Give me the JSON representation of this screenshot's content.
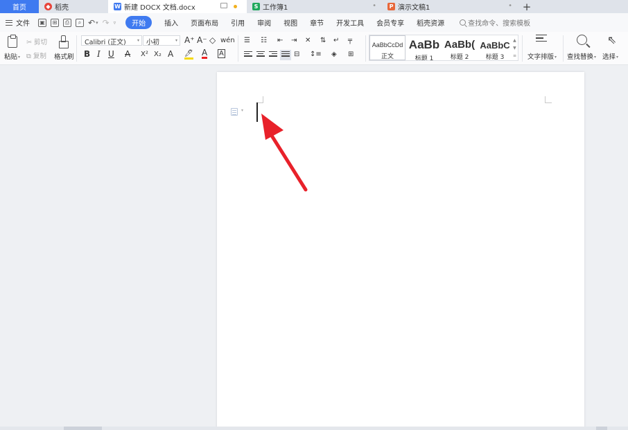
{
  "tabs": [
    {
      "id": "home",
      "label": "首页",
      "active": false
    },
    {
      "id": "daoke",
      "label": "稻壳",
      "icon": "daoke-logo-icon",
      "icon_color": "#e8443a"
    },
    {
      "id": "doc",
      "label": "新建 DOCX 文档.docx",
      "icon": "writer-doc-icon",
      "icon_color": "#3f7af0",
      "active": true
    },
    {
      "id": "sheet",
      "label": "工作簿1",
      "icon": "spreadsheet-icon",
      "icon_color": "#1fa85c"
    },
    {
      "id": "ppt",
      "label": "演示文稿1",
      "icon": "presentation-icon",
      "icon_color": "#e8673a"
    }
  ],
  "menu": {
    "file": "文件",
    "items": [
      "开始",
      "插入",
      "页面布局",
      "引用",
      "审阅",
      "视图",
      "章节",
      "开发工具",
      "会员专享",
      "稻壳资源"
    ],
    "active": "开始",
    "search_placeholder": "查找命令、搜索模板"
  },
  "ribbon": {
    "paste": "粘贴",
    "cut": "剪切",
    "copy": "复制",
    "format_painter": "格式刷",
    "font_name": "Calibri (正文)",
    "font_size": "小初",
    "font_glyphs": {
      "grow": "A⁺",
      "shrink": "A⁻",
      "clear": "◇",
      "phonetic": "wén",
      "bold": "B",
      "italic": "I",
      "underline": "U",
      "strike": "A",
      "superscript": "X²",
      "subscript": "X₂",
      "effect": "A",
      "highlight": "🖊",
      "font_color": "A",
      "char_border": "A"
    },
    "styles": [
      {
        "sample": "AaBbCcDd",
        "name": "正文"
      },
      {
        "sample": "AaBb",
        "name": "标题 1"
      },
      {
        "sample": "AaBb(",
        "name": "标题 2"
      },
      {
        "sample": "AaBbC",
        "name": "标题 3"
      }
    ],
    "text_layout": "文字排版",
    "find_replace": "查找替换",
    "select": "选择"
  },
  "colors": {
    "accent": "#3f7af0",
    "annotation_arrow": "#e8212a",
    "highlight": "#f5d90a",
    "font_color": "#e22222"
  }
}
